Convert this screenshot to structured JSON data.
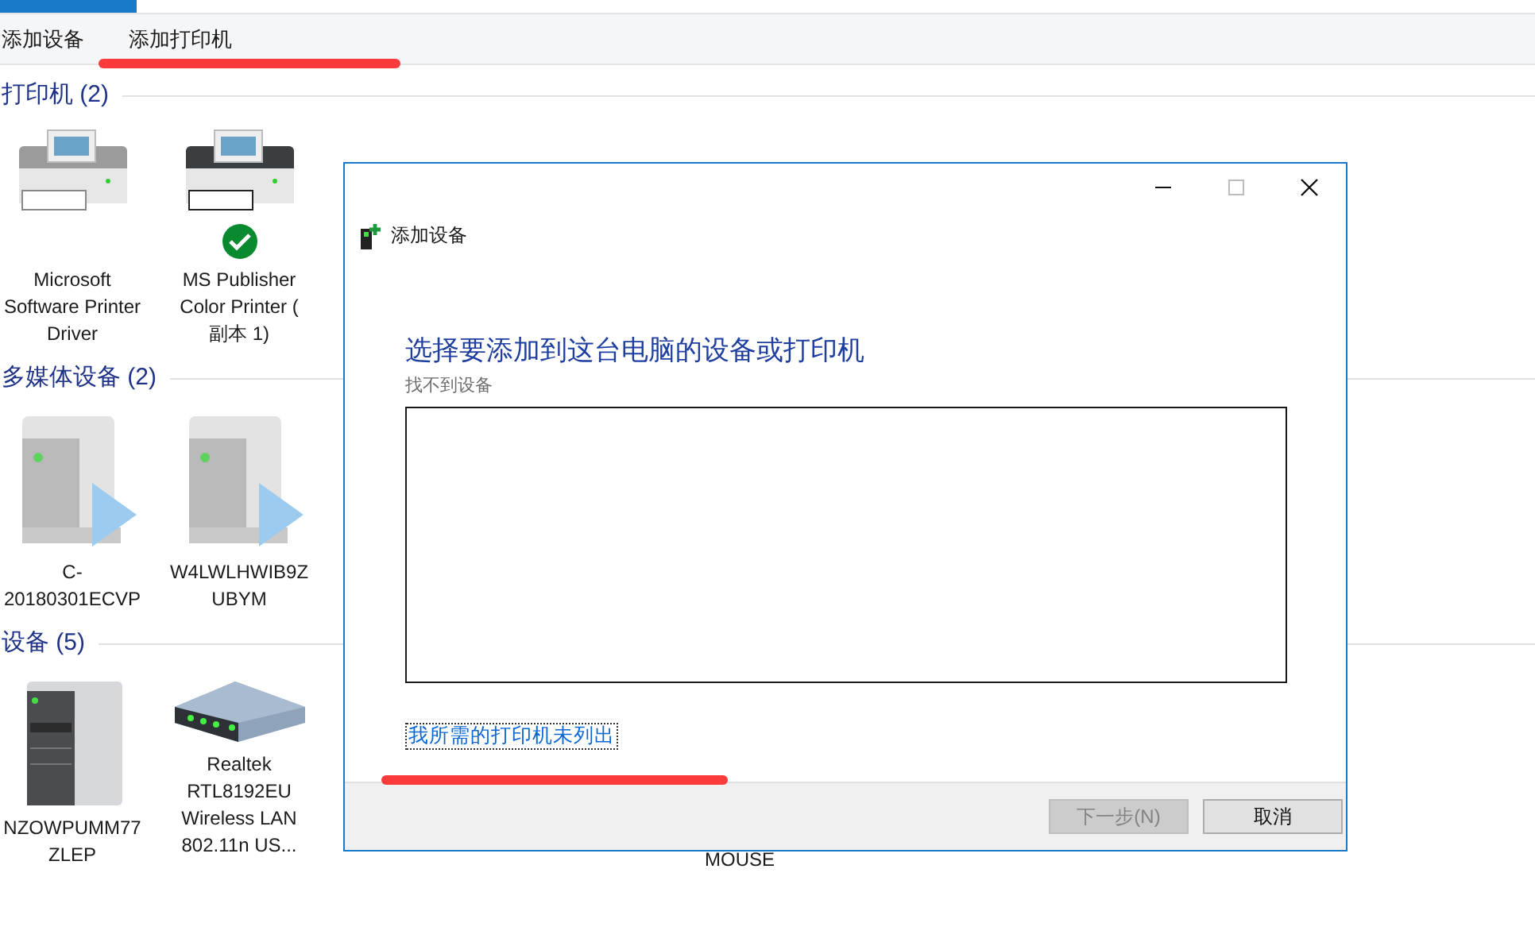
{
  "toolbar": {
    "items": [
      {
        "label": "添加设备"
      },
      {
        "label": "添加打印机"
      }
    ]
  },
  "sections": [
    {
      "title": "打印机 (2)",
      "devices": [
        {
          "kind": "printer",
          "label": "Microsoft Software Printer Driver",
          "default": false
        },
        {
          "kind": "printer-dark",
          "label": "MS Publisher Color Printer ( 副本 1)",
          "default": true
        }
      ]
    },
    {
      "title": "多媒体设备 (2)",
      "devices": [
        {
          "kind": "media",
          "label": "C-20180301ECVP"
        },
        {
          "kind": "media",
          "label": "W4LWLHWIB9ZUBYM"
        }
      ]
    },
    {
      "title": "设备 (5)",
      "devices": [
        {
          "kind": "tower",
          "label": "NZOWPUMM77ZLEP"
        },
        {
          "kind": "router",
          "label": "Realtek RTL8192EU Wireless LAN 802.11n US..."
        },
        {
          "kind": "covered",
          "label": "MOUSE"
        }
      ]
    }
  ],
  "dialog": {
    "title": "添加设备",
    "heading": "选择要添加到这台电脑的设备或打印机",
    "status": "找不到设备",
    "link": "我所需的打印机未列出",
    "buttons": [
      {
        "label": "下一步(N)",
        "disabled": true
      },
      {
        "label": "取消",
        "disabled": false
      }
    ]
  }
}
